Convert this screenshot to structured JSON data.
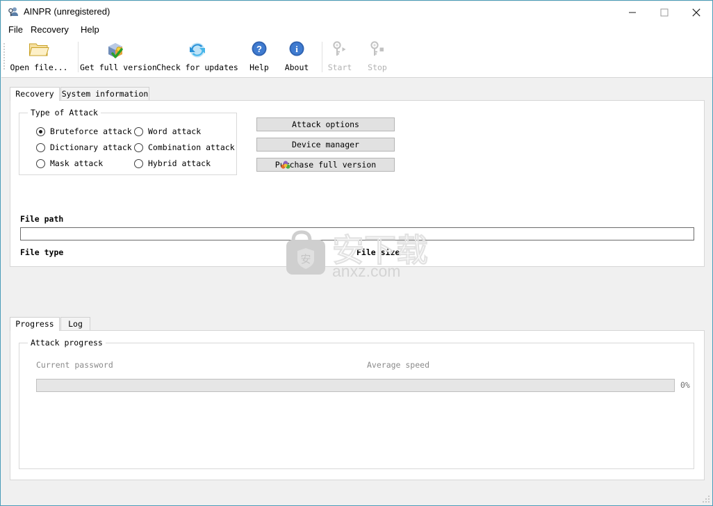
{
  "window": {
    "title": "AINPR (unregistered)",
    "icon": "app-key-person-icon",
    "border_color": "#4a9cb8",
    "controls": {
      "minimize": "minimize-icon",
      "maximize": "maximize-icon",
      "close": "close-icon"
    }
  },
  "menu": {
    "items": [
      {
        "label": "File"
      },
      {
        "label": "Recovery"
      },
      {
        "label": "Help"
      }
    ]
  },
  "toolbar": {
    "items": [
      {
        "label": "Open file...",
        "icon": "open-folder-icon",
        "disabled": false
      },
      {
        "label": "Get full version",
        "icon": "package-check-icon",
        "disabled": false
      },
      {
        "label": "Check for updates",
        "icon": "refresh-globe-icon",
        "disabled": false
      },
      {
        "label": "Help",
        "icon": "question-circle-icon",
        "disabled": false
      },
      {
        "label": "About",
        "icon": "info-circle-icon",
        "disabled": false
      },
      {
        "label": "Start",
        "icon": "key-play-icon",
        "disabled": true
      },
      {
        "label": "Stop",
        "icon": "key-stop-icon",
        "disabled": true
      }
    ]
  },
  "main_tabs": {
    "items": [
      {
        "label": "Recovery",
        "active": true
      },
      {
        "label": "System information",
        "active": false
      }
    ]
  },
  "recovery": {
    "attack_group": {
      "title": "Type of Attack",
      "options": [
        {
          "label": "Bruteforce attack",
          "selected": true
        },
        {
          "label": "Dictionary attack",
          "selected": false
        },
        {
          "label": "Mask attack",
          "selected": false
        },
        {
          "label": "Word attack",
          "selected": false
        },
        {
          "label": "Combination attack",
          "selected": false
        },
        {
          "label": "Hybrid attack",
          "selected": false
        }
      ]
    },
    "buttons": [
      {
        "label": "Attack options",
        "icon": null
      },
      {
        "label": "Device manager",
        "icon": null
      },
      {
        "label": "Purchase full version",
        "icon": "flower-icon"
      }
    ],
    "file_path_label": "File path",
    "file_path_value": "",
    "file_path_placeholder": "",
    "file_type_label": "File type",
    "file_type_value": "",
    "file_size_label": "File size",
    "file_size_value": ""
  },
  "bottom_tabs": {
    "items": [
      {
        "label": "Progress",
        "active": true
      },
      {
        "label": "Log",
        "active": false
      }
    ]
  },
  "progress": {
    "group_title": "Attack progress",
    "current_password_label": "Current password",
    "current_password_value": "",
    "average_speed_label": "Average speed",
    "average_speed_value": "",
    "percent_label": "0%",
    "percent_value": 0
  },
  "watermark": {
    "cn_text": "安下载",
    "site": "anxz.com",
    "badge_char": "安"
  }
}
